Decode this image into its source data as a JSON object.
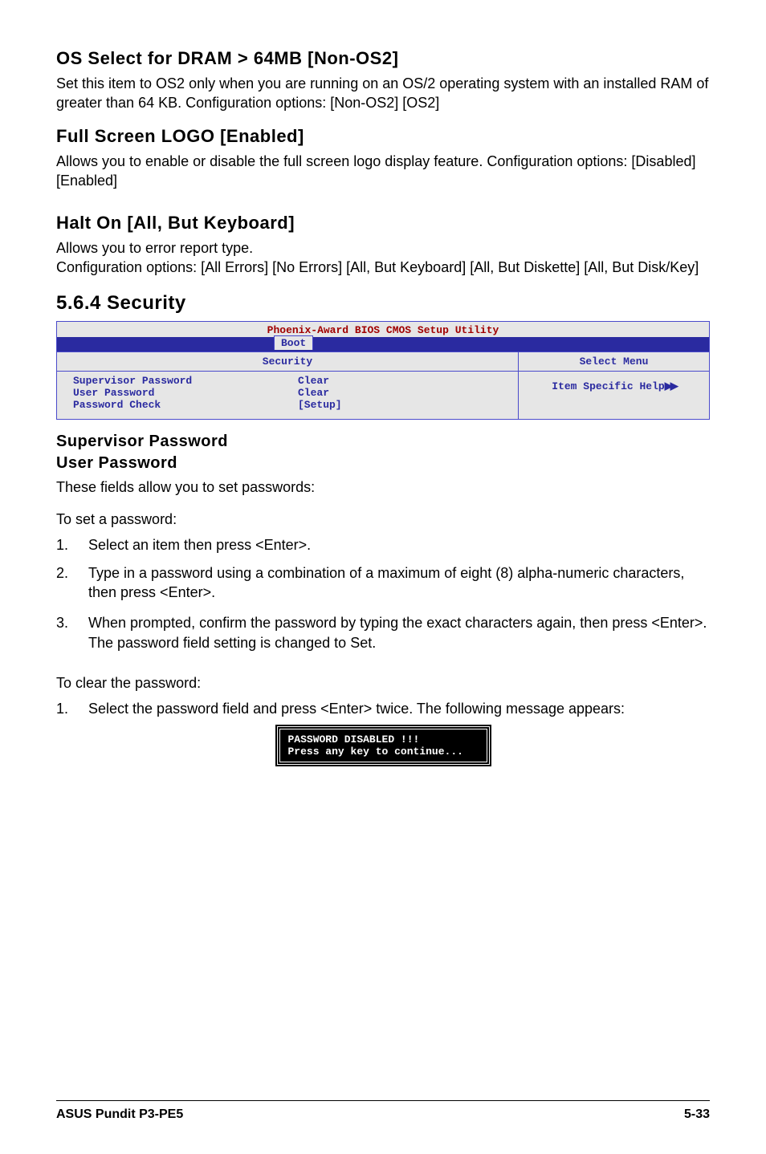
{
  "sec1": {
    "heading": "OS Select for DRAM > 64MB [Non-OS2]",
    "body": "Set this item to OS2 only when you are running on an OS/2 operating system with an installed RAM of greater than 64 KB. Configuration options: [Non-OS2] [OS2]"
  },
  "sec2": {
    "heading": "Full Screen LOGO [Enabled]",
    "body": "Allows you to enable or disable the full screen logo display feature. Configuration options: [Disabled] [Enabled]"
  },
  "sec3": {
    "heading": "Halt On [All, But Keyboard]",
    "body": "Allows you to error report type.\nConfiguration options: [All Errors] [No Errors] [All, But Keyboard] [All, But Diskette] [All, But Disk/Key]"
  },
  "sec4": {
    "heading": "5.6.4   Security"
  },
  "bios": {
    "title": "Phoenix-Award BIOS CMOS Setup Utility",
    "tab": "Boot",
    "security_label": "Security",
    "select_menu": "Select Menu",
    "rows": [
      {
        "label": "Supervisor Password",
        "value": "Clear"
      },
      {
        "label": "User Password",
        "value": "Clear"
      },
      {
        "label": "Password Check",
        "value": "[Setup]"
      }
    ],
    "help": "Item Specific Help"
  },
  "sec5": {
    "heading1": "Supervisor Password",
    "heading2": "User Password",
    "intro": "These fields allow you to set passwords:",
    "to_set": "To set a password:",
    "steps_set": [
      {
        "num": "1.",
        "text": "Select an item then press <Enter>."
      },
      {
        "num": "2.",
        "text": "Type in a password using a combination of a maximum of eight (8) alpha-numeric characters, then press <Enter>."
      },
      {
        "num": "3.",
        "text": "When prompted, confirm the password by typing the exact characters again, then press <Enter>. The password field setting is changed to Set."
      }
    ],
    "to_clear": "To clear the password:",
    "steps_clear": [
      {
        "num": "1.",
        "text": "Select the password field and press <Enter> twice. The following message appears:"
      }
    ]
  },
  "pwdbox": {
    "line1": "PASSWORD DISABLED !!!",
    "line2": "Press any key to continue..."
  },
  "footer": {
    "left": "ASUS Pundit P3-PE5",
    "right": "5-33"
  }
}
